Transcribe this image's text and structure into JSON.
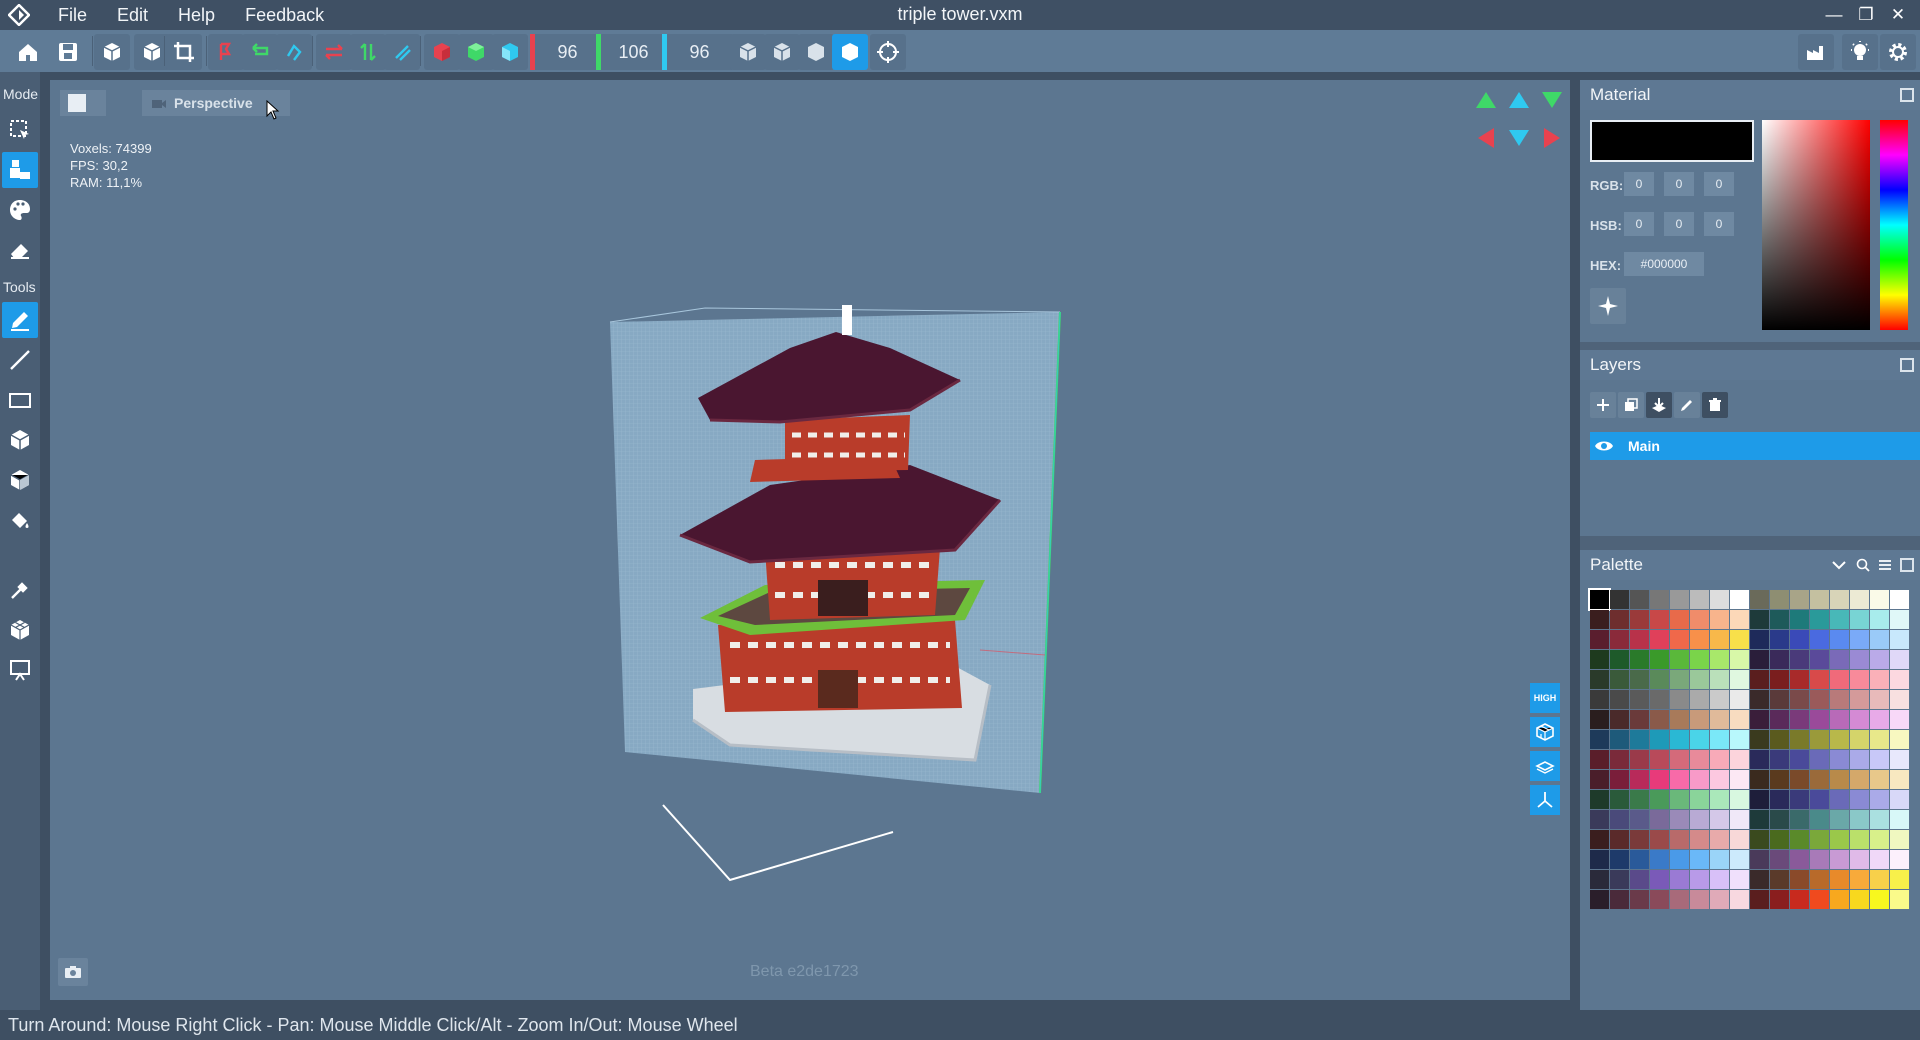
{
  "window": {
    "title": "triple tower.vxm",
    "menu": [
      "File",
      "Edit",
      "Help",
      "Feedback"
    ],
    "controls": [
      "minimize-icon",
      "restore-icon",
      "close-icon"
    ]
  },
  "toolbar": {
    "dims": {
      "x": "96",
      "y": "106",
      "z": "96"
    },
    "colors": {
      "x": "#e8424f",
      "y": "#3fd868",
      "z": "#2fc9f0",
      "accent": "#1e9be8"
    }
  },
  "leftbar": {
    "mode_label": "Mode",
    "tools_label": "Tools"
  },
  "viewport": {
    "camera": "Perspective",
    "stats": {
      "voxels": "Voxels: 74399",
      "fps": "FPS: 30,2",
      "ram": "RAM: 11,1%"
    },
    "quality_badge": "HIGH",
    "build": "Beta e2de1723"
  },
  "material": {
    "title": "Material",
    "rgb_label": "RGB:",
    "hsb_label": "HSB:",
    "hex_label": "HEX:",
    "rgb": [
      "0",
      "0",
      "0"
    ],
    "hsb": [
      "0",
      "0",
      "0"
    ],
    "hex": "#000000",
    "current_color": "#000000"
  },
  "layers": {
    "title": "Layers",
    "items": [
      {
        "name": "Main",
        "visible": true
      }
    ]
  },
  "palette": {
    "title": "Palette",
    "colors": [
      "#000000",
      "#333333",
      "#555555",
      "#777777",
      "#999999",
      "#bbbbbb",
      "#dddddd",
      "#ffffff",
      "#6a6a5a",
      "#8e8e72",
      "#a8a488",
      "#c4c0a0",
      "#d8d4b8",
      "#ecead4",
      "#fafae8",
      "#ffffff",
      "#3a1e1e",
      "#6e2e2e",
      "#9a3a3a",
      "#c84848",
      "#e86a4a",
      "#f08c6a",
      "#f8b48c",
      "#fcd8b8",
      "#1e3a3a",
      "#1e5a5a",
      "#1e7a7a",
      "#2a9a9a",
      "#48b8b8",
      "#78d4d4",
      "#a8ecec",
      "#e0f8f8",
      "#5a1e2e",
      "#8a2a3a",
      "#b8324a",
      "#e0405a",
      "#f0684a",
      "#f8904a",
      "#f8b84a",
      "#f8e04a",
      "#1e2a5a",
      "#2a3a8a",
      "#3a4ab8",
      "#4a6ae0",
      "#5a8af0",
      "#7aaaf8",
      "#9acaf8",
      "#c8e8fc",
      "#1e3a1e",
      "#1e5a2a",
      "#2a7a2a",
      "#3a9a2a",
      "#5ab83a",
      "#7ad44a",
      "#a8e86a",
      "#d8f8a8",
      "#2a1e3a",
      "#3a2a5a",
      "#4a3a7a",
      "#5a4a9a",
      "#7a6ab8",
      "#9a8ad4",
      "#baaae8",
      "#e0d8f8",
      "#2a3a2a",
      "#3a5a3a",
      "#4a6a4a",
      "#5a8a5a",
      "#7aa87a",
      "#9ac89a",
      "#bae0ba",
      "#e0f8e0",
      "#5a1e1e",
      "#7a1e1e",
      "#a82a2a",
      "#d84a4a",
      "#f06a7a",
      "#f88a9a",
      "#fab0b8",
      "#fcd8e0",
      "#3a3a3a",
      "#4a4a4a",
      "#5a5a5a",
      "#6a6a6a",
      "#8a8a8a",
      "#aaaaaa",
      "#cacaca",
      "#eaeaea",
      "#3a2a2a",
      "#5a3a3a",
      "#7a4a4a",
      "#9a5a5a",
      "#b87a7a",
      "#d49a9a",
      "#e8baba",
      "#f8e0e0",
      "#2a1e1e",
      "#4a2a2a",
      "#6a3a3a",
      "#8a5a4a",
      "#a87a5a",
      "#c89a7a",
      "#e0ba9a",
      "#f8dcc0",
      "#3a1e3a",
      "#5a2a5a",
      "#7a3a7a",
      "#9a4a9a",
      "#b86ab8",
      "#d48ad4",
      "#e8aae8",
      "#f8d8f8",
      "#1e3a5a",
      "#1e5a7a",
      "#1e7a9a",
      "#1e9ab8",
      "#2ab8d4",
      "#4ad4e8",
      "#7ae8f8",
      "#b8f8fc",
      "#3a3a1e",
      "#5a5a1e",
      "#7a7a2a",
      "#9a9a3a",
      "#b8b84a",
      "#d4d46a",
      "#e8e88a",
      "#f8f8c0",
      "#5a1e2a",
      "#7a2a3a",
      "#9a3a4a",
      "#b84a5a",
      "#d46a7a",
      "#e88a9a",
      "#f8aab8",
      "#fcd4dc",
      "#2a2a5a",
      "#3a3a7a",
      "#4a4a9a",
      "#6a6ab8",
      "#8a8ad4",
      "#aaaae8",
      "#c8c8f8",
      "#e8e8fc",
      "#4a1e2a",
      "#7a1e3a",
      "#b82a5a",
      "#e83a7a",
      "#f86aa8",
      "#f89ac8",
      "#fcc8e0",
      "#fce8f4",
      "#3a2a1e",
      "#5a3a1e",
      "#7a4a2a",
      "#9a6a3a",
      "#b88a4a",
      "#d4a86a",
      "#e8c88a",
      "#f8e8c0",
      "#1e3a2a",
      "#2a5a3a",
      "#3a7a4a",
      "#4a9a5a",
      "#6ab87a",
      "#8ad49a",
      "#aae8ba",
      "#d8f8e0",
      "#1e1e3a",
      "#2a2a5a",
      "#3a3a7a",
      "#4a4a9a",
      "#6a6ab8",
      "#8a8ad4",
      "#aaaae8",
      "#d8d8f8",
      "#3a3a5a",
      "#4a4a7a",
      "#5a5a8a",
      "#7a6a9a",
      "#9a8ab8",
      "#b8aad4",
      "#d4c8e8",
      "#f0e8f8",
      "#1e3a3a",
      "#2a4a4a",
      "#3a6a6a",
      "#4a8a8a",
      "#6aa8a8",
      "#8ac8c8",
      "#aae0e0",
      "#d8f8f8",
      "#3a1e1e",
      "#5a2a2a",
      "#7a3a3a",
      "#9a4a4a",
      "#b86a6a",
      "#d48a8a",
      "#e8aaaa",
      "#f8d8d8",
      "#3a4a1e",
      "#4a6a1e",
      "#5a8a2a",
      "#7aa83a",
      "#9ac84a",
      "#bae06a",
      "#d8f08a",
      "#f0f8c0",
      "#1e2a4a",
      "#1e3a6a",
      "#2a5a9a",
      "#3a7ac8",
      "#4a9ae8",
      "#6ab8f8",
      "#9ad4f8",
      "#cceafc",
      "#4a3a5a",
      "#6a4a7a",
      "#8a5a9a",
      "#a87ab8",
      "#c89ad4",
      "#e0bae8",
      "#f0d8f8",
      "#fcf0fc",
      "#2a2a3a",
      "#3a3a5a",
      "#5a4a8a",
      "#7a5ab8",
      "#9a7ad4",
      "#b89ae8",
      "#d8c0f8",
      "#f0e0fc",
      "#3a2a2a",
      "#5a3a2a",
      "#8a4a2a",
      "#b86a2a",
      "#e88a2a",
      "#f8aa3a",
      "#f8d04a",
      "#f8f04a",
      "#2a1e2a",
      "#4a2a3a",
      "#6a3a4a",
      "#8a4a5a",
      "#a86a7a",
      "#c88a9a",
      "#e0aab8",
      "#f8d8e0",
      "#5a1e1e",
      "#8a1e1e",
      "#c82a1e",
      "#f04a1e",
      "#f8a81e",
      "#f8d81e",
      "#f8f81e",
      "#fafa8a"
    ]
  },
  "status": {
    "hint": "Turn Around: Mouse Right Click - Pan: Mouse Middle Click/Alt - Zoom In/Out: Mouse Wheel"
  }
}
